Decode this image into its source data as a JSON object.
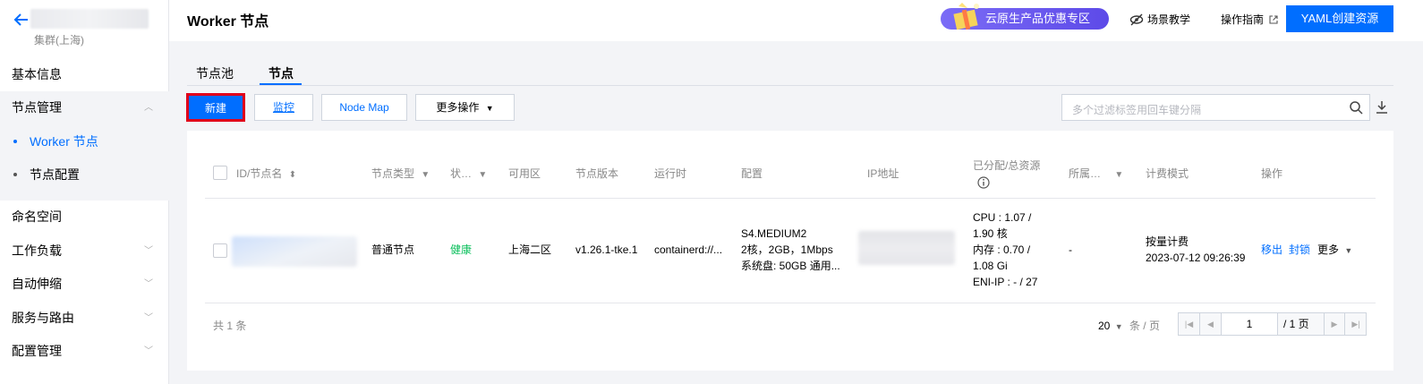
{
  "sidebar": {
    "cluster_sub": "集群(上海)",
    "items": {
      "basic": "基本信息",
      "node_mgmt": "节点管理",
      "worker_nodes": "Worker 节点",
      "node_config": "节点配置",
      "namespace": "命名空间",
      "workload": "工作负载",
      "autoscale": "自动伸缩",
      "service_route": "服务与路由",
      "config_mgmt": "配置管理"
    }
  },
  "header": {
    "title": "Worker 节点",
    "promo": "云原生产品优惠专区",
    "scene_teaching": "场景教学",
    "guide": "操作指南",
    "yaml_button": "YAML创建资源"
  },
  "tabs": {
    "pool": "节点池",
    "node": "节点"
  },
  "toolbar": {
    "new": "新建",
    "monitor": "监控",
    "node_map": "Node Map",
    "more_ops": "更多操作",
    "search_placeholder": "多个过滤标签用回车键分隔"
  },
  "table": {
    "headers": {
      "id": "ID/节点名",
      "type": "节点类型",
      "status": "状…",
      "zone": "可用区",
      "version": "节点版本",
      "runtime": "运行时",
      "config": "配置",
      "ip": "IP地址",
      "alloc": "已分配/总资源",
      "belong": "所属…",
      "billing": "计费模式",
      "ops": "操作"
    },
    "row": {
      "type": "普通节点",
      "status": "健康",
      "zone": "上海二区",
      "version": "v1.26.1-tke.1",
      "runtime": "containerd://...",
      "config_1": "S4.MEDIUM2",
      "config_2": "2核，2GB，1Mbps",
      "config_3": "系统盘: 50GB 通用...",
      "alloc_1": "CPU : 1.07 /",
      "alloc_2": "1.90 核",
      "alloc_3": "内存 : 0.70 /",
      "alloc_4": "1.08 Gi",
      "alloc_5": "ENI-IP : - / 27",
      "belong": "-",
      "billing_1": "按量计费",
      "billing_2": "2023-07-12 09:26:39",
      "op_remove": "移出",
      "op_cordon": "封锁",
      "op_more": "更多"
    }
  },
  "footer": {
    "total": "共 1 条",
    "page_size": "20",
    "page_size_unit": "条 / 页",
    "current_page": "1",
    "total_pages": "/ 1 页"
  }
}
